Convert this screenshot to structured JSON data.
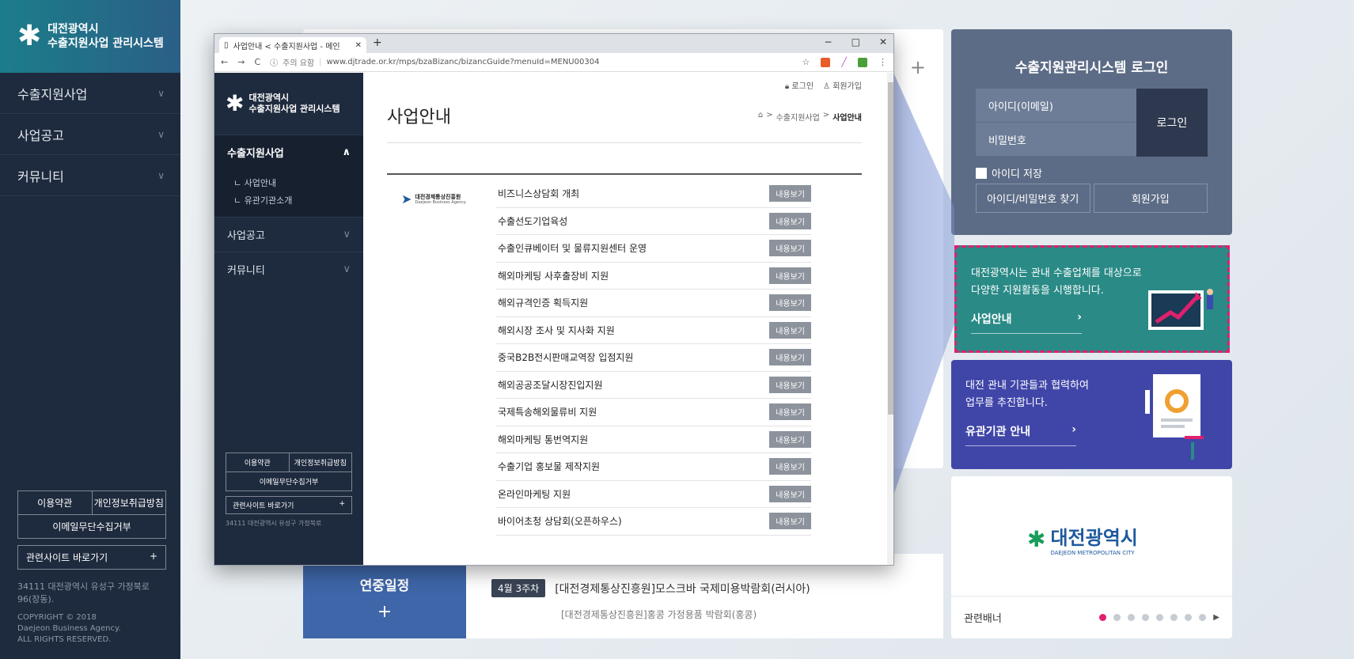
{
  "brand": {
    "line1": "대전광역시",
    "line2": "수출지원사업 관리시스템"
  },
  "bg_sidebar": {
    "menu": [
      "수출지원사업",
      "사업공고",
      "커뮤니티"
    ],
    "footer": {
      "terms": "이용약관",
      "privacy": "개인정보취급방침",
      "email_refuse": "이메일무단수집거부",
      "related_sites": "관련사이트 바로가기",
      "address": "34111 대전광역시 유성구 가정북로 96(장동).",
      "copyright": "COPYRIGHT © 2018",
      "company": "Daejeon Business Agency.",
      "rights": "ALL RIGHTS RESERVED."
    }
  },
  "login": {
    "title": "수출지원관리시스템 로그인",
    "id_placeholder": "아이디(이메일)",
    "pw_placeholder": "비밀번호",
    "login_button": "로그인",
    "save_id": "아이디 저장",
    "find_account": "아이디/비밀번호 찾기",
    "signup": "회원가입"
  },
  "promo_business": {
    "line1": "대전광역시는 관내 수출업체를 대상으로",
    "line2": "다양한 지원활동을 시행합니다.",
    "link": "사업안내",
    "arrow": "›"
  },
  "promo_agency": {
    "line1": "대전 관내 기관들과 협력하여",
    "line2": "업무를 추진합니다.",
    "link": "유관기관 안내",
    "arrow": "›"
  },
  "banner": {
    "logo_name": "대전광역시",
    "logo_sub": "DAEJEON METROPOLITAN CITY",
    "label": "관련배너",
    "dot_count": 8,
    "active_dot": 0,
    "next": "▶"
  },
  "schedule": {
    "title": "연중일정",
    "plus": "+",
    "rows": [
      {
        "week": "4월 3주차",
        "text": "[대전경제통상진흥원]모스크바 국제미용박람회(러시아)"
      },
      {
        "week": "",
        "text": "[대전경제통상진흥원]홍콩 가정용품 박람회(홍콩)"
      }
    ]
  },
  "browser": {
    "tab_title": "사업안내 < 수출지원사업 - 메인",
    "new_tab": "+",
    "minimize": "−",
    "maximize": "□",
    "close": "✕",
    "security": "주의 요함",
    "url": "www.djtrade.or.kr/mps/bzaBizanc/bizancGuide?menuId=MENU00304"
  },
  "page": {
    "util_login": "로그인",
    "util_signup": "회원가입",
    "title": "사업안내",
    "crumb_parent": "수출지원사업",
    "crumb_current": "사업안내",
    "agency_name": "대전경제통상진흥원",
    "agency_en": "Daejeon Business Agency",
    "view_label": "내용보기",
    "items": [
      "비즈니스상담회 개최",
      "수출선도기업육성",
      "수출인큐베이터 및 물류지원센터 운영",
      "해외마케팅 사후출장비 지원",
      "해외규격인증 획득지원",
      "해외시장 조사 및 지사화 지원",
      "중국B2B전시판매교역장 입점지원",
      "해외공공조달시장진입지원",
      "국제특송해외물류비 지원",
      "해외마케팅 통번역지원",
      "수출기업 홍보물 제작지원",
      "온라인마케팅 지원",
      "바이어초청 상담회(오픈하우스)"
    ]
  },
  "bw_side": {
    "menu_active": "수출지원사업",
    "sub": [
      "사업안내",
      "유관기관소개"
    ],
    "menu_others": [
      "사업공고",
      "커뮤니티"
    ],
    "footer": {
      "terms": "이용약관",
      "privacy": "개인정보취급방침",
      "email_refuse": "이메일무단수집거부",
      "related_sites": "관련사이트 바로가기",
      "address": "34111 대전광역시 유성구 가정북로"
    }
  }
}
